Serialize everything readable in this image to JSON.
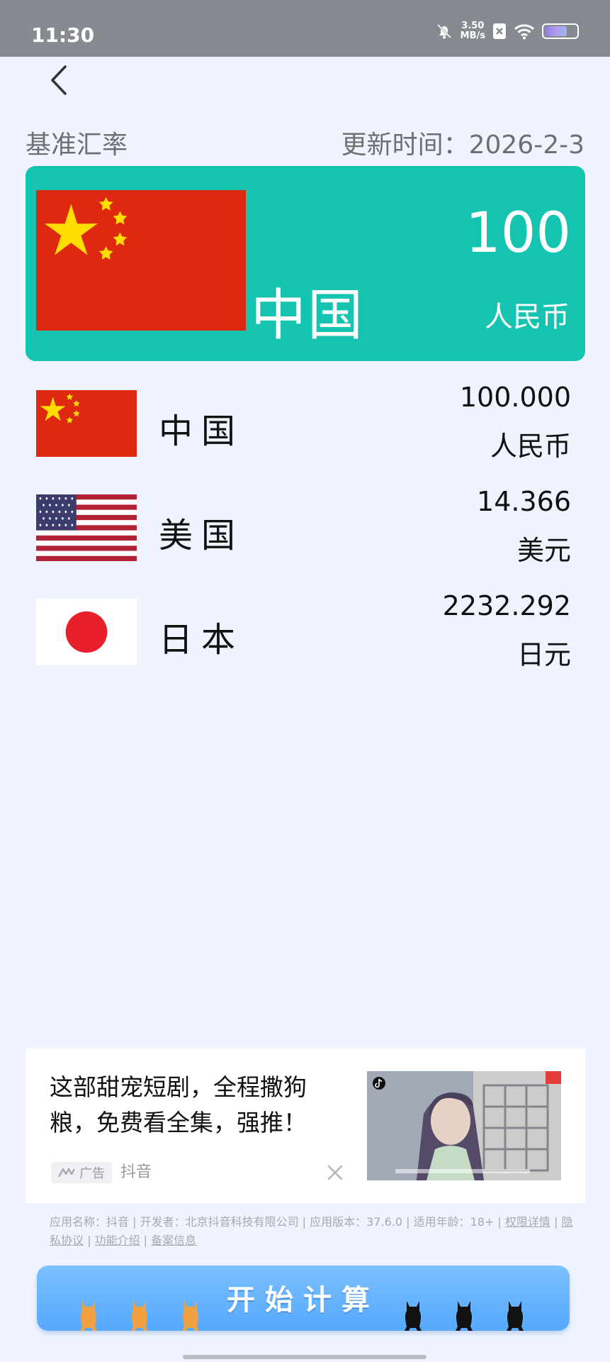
{
  "status_bar": {
    "time": "11:30",
    "net_speed_value": "3.50",
    "net_speed_unit": "MB/s",
    "battery_level": 0.7
  },
  "header": {
    "base_label": "基准汇率",
    "update_prefix": "更新时间：",
    "update_date": "2026-2-3"
  },
  "base": {
    "country": "中国",
    "amount": "100",
    "currency": "人民币",
    "flag": "china-flag"
  },
  "rates": [
    {
      "country": "中国",
      "value": "100.000",
      "unit": "人民币",
      "flag": "china-flag"
    },
    {
      "country": "美国",
      "value": "14.366",
      "unit": "美元",
      "flag": "usa-flag"
    },
    {
      "country": "日本",
      "value": "2232.292",
      "unit": "日元",
      "flag": "japan-flag"
    }
  ],
  "ad": {
    "text": "这部甜宠短剧，全程撒狗粮，免费看全集，强推！",
    "badge": "广告",
    "source": "抖音",
    "info_text": "应用名称：抖音 | 开发者：北京抖音科技有限公司 | 应用版本：37.6.0 | 适用年龄：18+ | ",
    "links": [
      "权限详情",
      "隐私协议",
      "功能介绍",
      "备案信息"
    ]
  },
  "actions": {
    "calculate_label": "开始计算"
  },
  "colors": {
    "accent": "#15c3b1",
    "background": "#eef3fd",
    "button": "#55a9ff",
    "china_red": "#de2910",
    "china_star": "#ffde00"
  }
}
